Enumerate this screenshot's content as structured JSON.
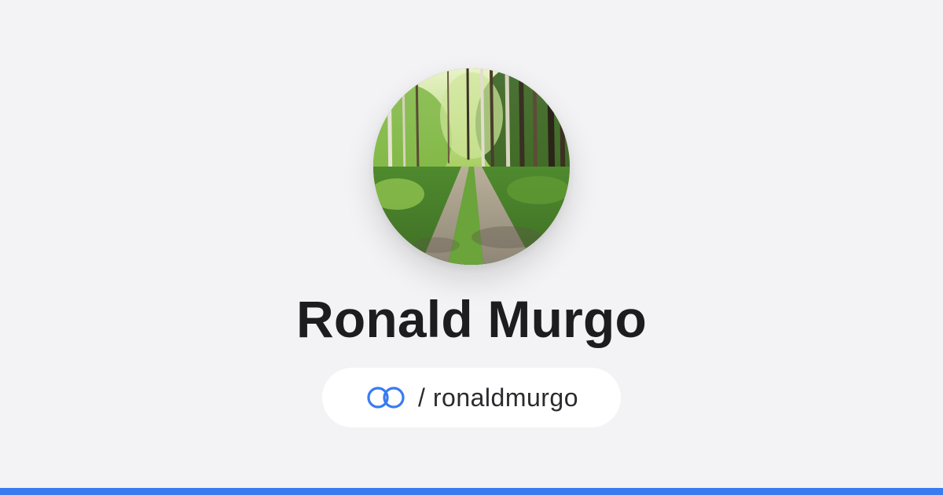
{
  "profile": {
    "name": "Ronald Murgo",
    "handle_separator": "/",
    "handle": "ronaldmurgo",
    "avatar_description_icon": "profile-photo-forest-path"
  },
  "brand": {
    "icon": "linked-rings-icon",
    "accent_color": "#3a7bf0",
    "background_color": "#f3f3f5"
  }
}
